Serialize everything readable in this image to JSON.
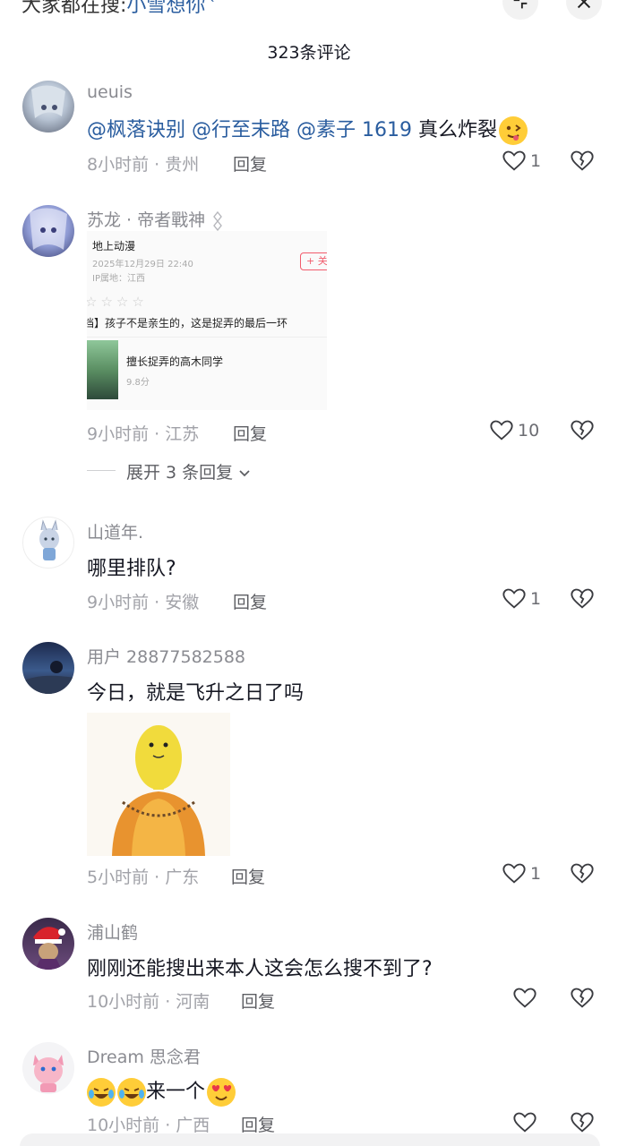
{
  "search": {
    "prefix": "大家都在搜:",
    "term": "小雪想你"
  },
  "header": {
    "title": "323条评论"
  },
  "comments": [
    {
      "username": "ueuis",
      "mentions": [
        "@枫落诀别",
        "@行至末路",
        "@素子 1619"
      ],
      "text": "真么炸裂",
      "time_location": "8小时前 · 贵州",
      "reply_label": "回复",
      "likes": "1"
    },
    {
      "username": "苏龙 · 帝者戰神",
      "image_card": {
        "title": "地上动漫",
        "date": "2025年12月29日 22:40",
        "ip": "IP属地：江西",
        "follow": "+ 关",
        "stars": "☆☆☆☆",
        "review": "档】孩子不是亲生的，这是捉弄的最后一环",
        "anime_name": "擅长捉弄的高木同学",
        "score": "9.8分"
      },
      "time_location": "9小时前 · 江苏",
      "reply_label": "回复",
      "likes": "10",
      "expand_label": "展开 3 条回复"
    },
    {
      "username": "山道年.",
      "text": "哪里排队?",
      "time_location": "9小时前 · 安徽",
      "reply_label": "回复",
      "likes": "1"
    },
    {
      "username": "用户 28877582588",
      "text": "今日，就是飞升之日了吗",
      "time_location": "5小时前 · 广东",
      "reply_label": "回复",
      "likes": "1"
    },
    {
      "username": "浦山鹤",
      "text": "刚刚还能搜出来本人这会怎么搜不到了?",
      "time_location": "10小时前 · 河南",
      "reply_label": "回复",
      "likes": ""
    },
    {
      "username": "Dream 思念君",
      "text": "来一个",
      "time_location": "10小时前 · 广西",
      "reply_label": "回复",
      "likes": ""
    }
  ],
  "colors": {
    "mention": "#2a5d9f",
    "meta": "#a1a2a8",
    "username": "#8a8b91"
  }
}
